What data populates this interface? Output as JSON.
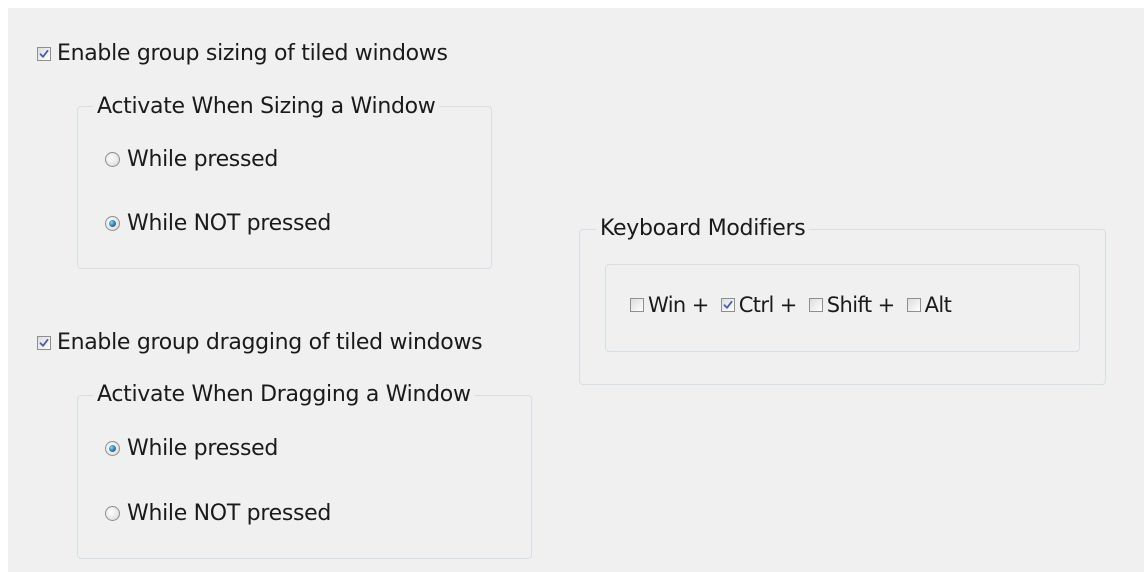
{
  "sizing": {
    "enable_label": "Enable group sizing of tiled windows",
    "enable_checked": true,
    "group_title": "Activate When Sizing a Window",
    "options": [
      {
        "label": "While pressed",
        "selected": false
      },
      {
        "label": "While NOT pressed",
        "selected": true
      }
    ]
  },
  "dragging": {
    "enable_label": "Enable group dragging of tiled windows",
    "enable_checked": true,
    "group_title": "Activate When Dragging a Window",
    "options": [
      {
        "label": "While pressed",
        "selected": true
      },
      {
        "label": "While NOT pressed",
        "selected": false
      }
    ]
  },
  "modifiers": {
    "group_title": "Keyboard Modifiers",
    "items": [
      {
        "label": "Win +",
        "checked": false
      },
      {
        "label": "Ctrl +",
        "checked": true
      },
      {
        "label": "Shift +",
        "checked": false
      },
      {
        "label": "Alt",
        "checked": false
      }
    ]
  },
  "colors": {
    "panel_bg": "#f0f0f0",
    "check_mark": "#4a5fa8",
    "radio_dot": "#1f6fa8",
    "group_border": "#d5dfe5"
  }
}
